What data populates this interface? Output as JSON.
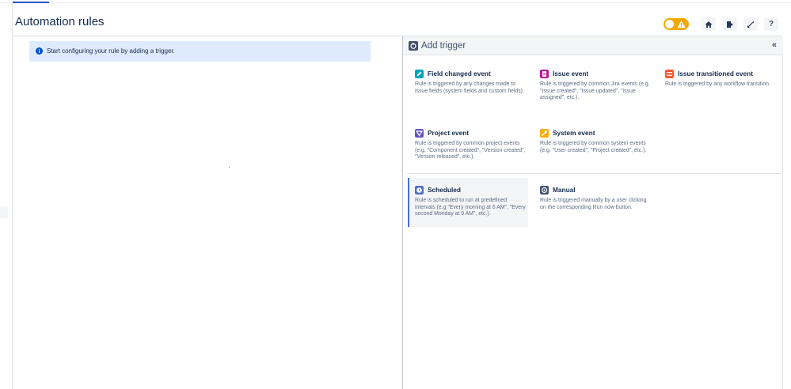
{
  "page": {
    "title": "Automation rules"
  },
  "notice": {
    "text": "Start configuring your rule by adding a trigger."
  },
  "panel": {
    "title": "Add trigger",
    "collapse_label": "«"
  },
  "header_buttons": {
    "help_label": "?"
  },
  "triggers": [
    {
      "title": "Field changed event",
      "description": "Rule is triggered by any changes made to issue fields (system fields and custom fields).",
      "icon": "pencil-icon",
      "color": "#00a3bf"
    },
    {
      "title": "Issue event",
      "description": "Rule is triggered by common Jira events (e.g. \"Issue created\", \"Issue updated\", \"issue assigned\", etc.).",
      "icon": "document-icon",
      "color": "#c1119a"
    },
    {
      "title": "Issue transitioned event",
      "description": "Rule is triggered by any workflow transition.",
      "icon": "transition-icon",
      "color": "#ff5630"
    },
    {
      "title": "Project event",
      "description": "Rule is triggered by common project events (e.g. \"Component created\", \"Version created\", \"Version released\", etc.).",
      "icon": "project-icon",
      "color": "#6554c0"
    },
    {
      "title": "System event",
      "description": "Rule is triggered by common system events (e.g. \"User created\", \"Project created\", etc.).",
      "icon": "wrench-icon",
      "color": "#ffab00"
    },
    {
      "title": "Scheduled",
      "description": "Rule is scheduled to run at predefined intervals (e.g \"Every morning at 6 AM\", \"Every second Monday at 9 AM\", etc.).",
      "icon": "clock-icon",
      "color": "#4c6fd1"
    },
    {
      "title": "Manual",
      "description": "Rule is triggered manually by a user clicking on the corresponding Run now button.",
      "icon": "run-icon",
      "color": "#42526e"
    }
  ],
  "colors": {
    "toggle": "#f5a800",
    "notice_bg": "#deebff",
    "selected_accent": "#4c6fd1"
  }
}
